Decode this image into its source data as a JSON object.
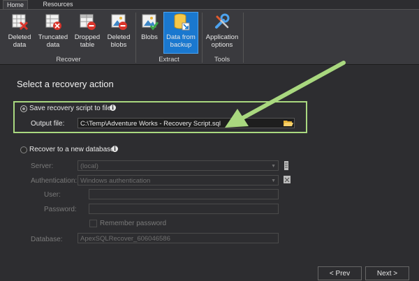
{
  "tabs": [
    {
      "label": "Home",
      "active": true
    },
    {
      "label": "Resources",
      "active": false
    }
  ],
  "ribbon": {
    "groups": {
      "recover": "Recover",
      "extract": "Extract",
      "tools": "Tools"
    },
    "buttons": {
      "deleted_data": "Deleted\ndata",
      "truncated_data": "Truncated\ndata",
      "dropped_table": "Dropped\ntable",
      "deleted_blobs": "Deleted\nblobs",
      "blobs": "Blobs",
      "data_from_backup": "Data from\nbackup",
      "application_options": "Application\noptions"
    },
    "selected_button": "data_from_backup"
  },
  "page": {
    "title": "Select a recovery action"
  },
  "option_script": {
    "label": "Save recovery script to file",
    "selected": true,
    "output_label": "Output file:",
    "output_value": "C:\\Temp\\Adventure Works - Recovery Script.sql"
  },
  "option_db": {
    "label": "Recover to a new database",
    "selected": false,
    "server_label": "Server:",
    "server_value": "(local)",
    "auth_label": "Authentication:",
    "auth_value": "Windows authentication",
    "user_label": "User:",
    "user_value": "",
    "password_label": "Password:",
    "password_value": "",
    "remember_label": "Remember password",
    "remember_checked": false,
    "database_label": "Database:",
    "database_value": "ApexSQLRecover_606046586"
  },
  "nav": {
    "prev": "< Prev",
    "next": "Next >"
  },
  "colors": {
    "highlight": "#a9d87f",
    "selected_button": "#1a78cf",
    "background": "#2d2d30"
  }
}
